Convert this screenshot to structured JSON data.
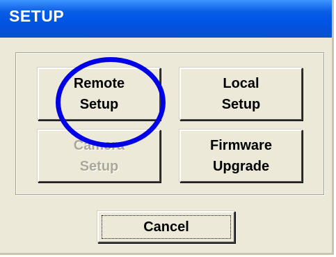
{
  "window": {
    "title": "SETUP"
  },
  "buttons": {
    "remote_setup": {
      "label": "Remote\nSetup",
      "enabled": true
    },
    "local_setup": {
      "label": "Local\nSetup",
      "enabled": true
    },
    "camera_setup": {
      "label": "Camera\nSetup",
      "enabled": false
    },
    "firmware_upgrade": {
      "label": "Firmware\nUpgrade",
      "enabled": true
    },
    "cancel": {
      "label": "Cancel"
    }
  },
  "annotation": {
    "highlight_color": "#0000e6",
    "shape": "circle"
  },
  "colors": {
    "titlebar": "#0054e3",
    "dialog_bg": "#ece9d8"
  }
}
